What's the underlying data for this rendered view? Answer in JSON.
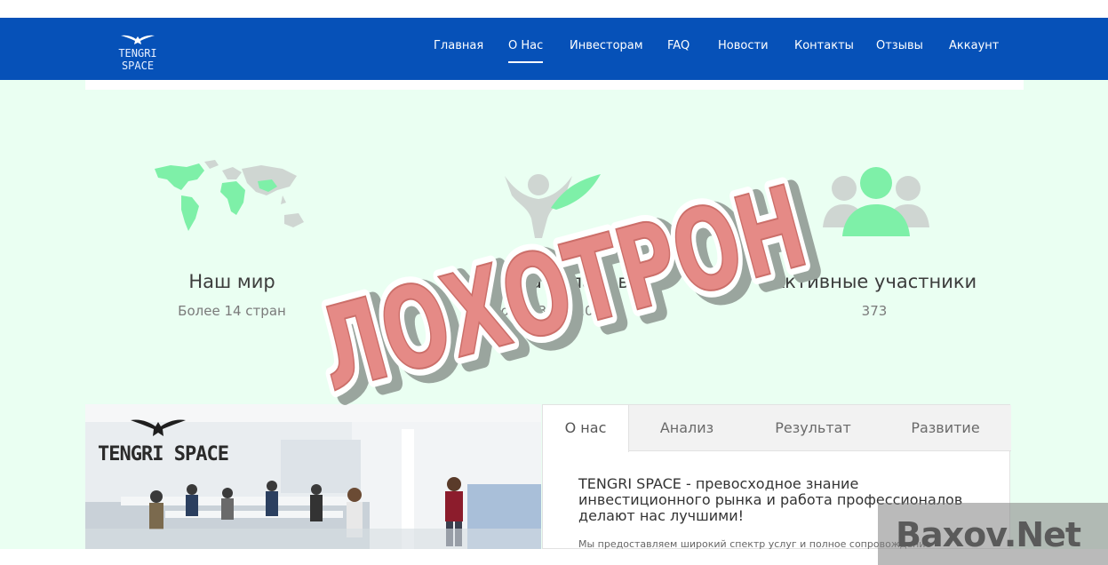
{
  "header": {
    "logo_text": "TENGRI SPACE",
    "nav": [
      {
        "label": "Главная"
      },
      {
        "label": "О Нас",
        "active": true
      },
      {
        "label": "Инвесторам"
      },
      {
        "label": "FAQ"
      },
      {
        "label": "Новости"
      },
      {
        "label": "Контакты"
      },
      {
        "label": "Отзывы"
      },
      {
        "label": "Аккаунт"
      }
    ]
  },
  "stats": [
    {
      "icon": "world-map-icon",
      "title": "Наш мир",
      "value": "Более 14 стран"
    },
    {
      "icon": "investor-figure-icon",
      "title": "Сумма вкладов",
      "value": "более 32715.00 $"
    },
    {
      "icon": "users-group-icon",
      "title": "Активные участники",
      "value": "373"
    }
  ],
  "about": {
    "photo_logo_text": "TENGRI SPACE",
    "tabs": [
      {
        "label": "О нас",
        "active": true
      },
      {
        "label": "Анализ"
      },
      {
        "label": "Результат"
      },
      {
        "label": "Развитие"
      }
    ],
    "heading": "TENGRI SPACE - превосходное знание инвестиционного рынка и работа профессионалов делают нас лучшими!",
    "body": "Мы предоставляем широкий спектр услуг и полное сопровождение"
  },
  "overlay": {
    "stamp_text": "ЛОХОТРОН",
    "watermark_text": "Baxov.Net"
  },
  "colors": {
    "navbar": "#0651b8",
    "background": "#eafff2",
    "accent_green": "#7ef0a8",
    "stamp_red": "#e58a86"
  }
}
